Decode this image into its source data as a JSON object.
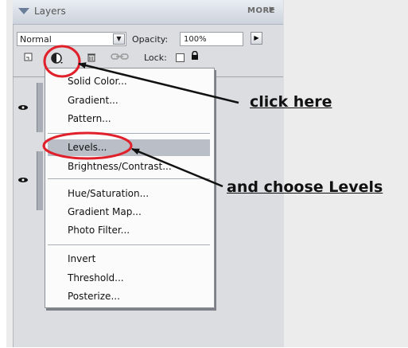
{
  "panel": {
    "title": "Layers",
    "more_label": "MORE",
    "more_arrow": "▶"
  },
  "blend": {
    "value": "Normal",
    "dropdown_arrow": "▼"
  },
  "opacity": {
    "label": "Opacity:",
    "value": "100%",
    "arrow": "▶"
  },
  "lock": {
    "label": "Lock:"
  },
  "menu": {
    "items": [
      "Solid Color...",
      "Gradient...",
      "Pattern...",
      "Levels...",
      "Brightness/Contrast...",
      "Hue/Saturation...",
      "Gradient Map...",
      "Photo Filter...",
      "Invert",
      "Threshold...",
      "Posterize..."
    ],
    "selected": "Levels..."
  },
  "annotations": {
    "click_here": "click here",
    "choose_levels": "and choose Levels"
  },
  "colors": {
    "highlight_circle": "#e0202a",
    "selected_item_bg": "#b9bec7"
  },
  "icons": [
    "collapse-triangle-icon",
    "new-layer-icon",
    "adjustment-layer-icon",
    "trash-icon",
    "link-icon",
    "lock-transparency-icon",
    "lock-icon",
    "eye-icon"
  ]
}
